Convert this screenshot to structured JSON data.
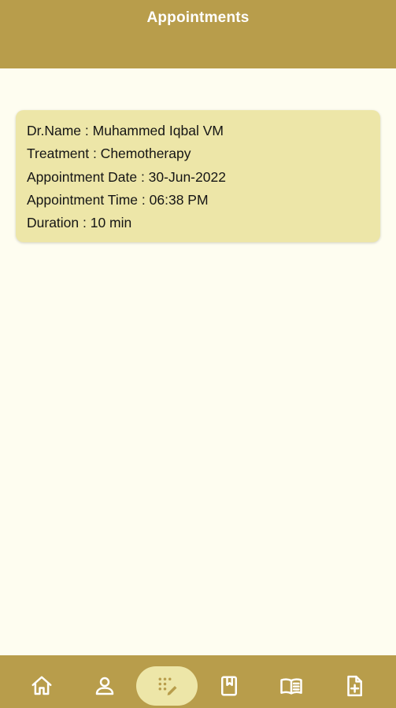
{
  "header": {
    "title": "Appointments"
  },
  "appointments": [
    {
      "doctor_line": "Dr.Name : Muhammed Iqbal VM",
      "treatment_line": "Treatment : Chemotherapy",
      "date_line": "Appointment Date : 30-Jun-2022",
      "time_line": "Appointment Time : 06:38 PM",
      "duration_line": "Duration : 10 min"
    }
  ],
  "bottom_nav": {
    "items": [
      {
        "icon": "home-icon",
        "active": false
      },
      {
        "icon": "person-icon",
        "active": false
      },
      {
        "icon": "appointments-icon",
        "active": true
      },
      {
        "icon": "bookmark-book-icon",
        "active": false
      },
      {
        "icon": "open-book-icon",
        "active": false
      },
      {
        "icon": "add-document-icon",
        "active": false
      }
    ]
  },
  "colors": {
    "brand": "#b89d4b",
    "background": "#fefdf0",
    "card": "#ede6a8",
    "text": "#151515"
  }
}
